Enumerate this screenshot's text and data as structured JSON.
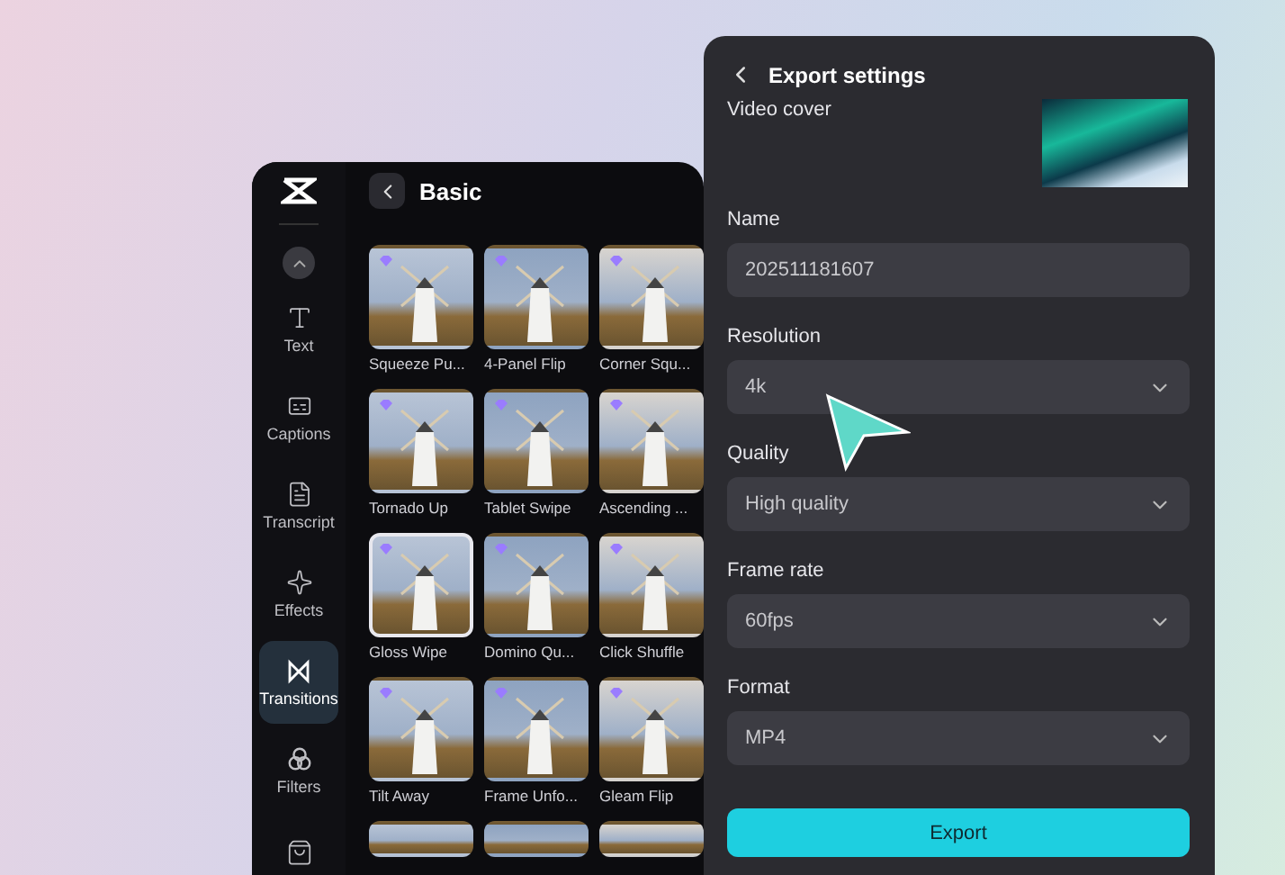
{
  "editor": {
    "title": "Basic",
    "sidebar": {
      "items": [
        {
          "label": "Text",
          "selected": false
        },
        {
          "label": "Captions",
          "selected": false
        },
        {
          "label": "Transcript",
          "selected": false
        },
        {
          "label": "Effects",
          "selected": false
        },
        {
          "label": "Transitions",
          "selected": true
        },
        {
          "label": "Filters",
          "selected": false
        }
      ]
    },
    "tiles": [
      {
        "label": "Squeeze Pu...",
        "selected": false
      },
      {
        "label": "4-Panel Flip",
        "selected": false
      },
      {
        "label": "Corner Squ...",
        "selected": false
      },
      {
        "label": "Tornado Up",
        "selected": false
      },
      {
        "label": "Tablet Swipe",
        "selected": false
      },
      {
        "label": "Ascending ...",
        "selected": false
      },
      {
        "label": "Gloss Wipe",
        "selected": true
      },
      {
        "label": "Domino Qu...",
        "selected": false
      },
      {
        "label": "Click Shuffle",
        "selected": false
      },
      {
        "label": "Tilt Away",
        "selected": false
      },
      {
        "label": "Frame Unfo...",
        "selected": false
      },
      {
        "label": "Gleam Flip",
        "selected": false
      }
    ]
  },
  "export": {
    "title": "Export settings",
    "cover_label": "Video cover",
    "fields": [
      {
        "label": "Name",
        "value": "202511181607",
        "kind": "text"
      },
      {
        "label": "Resolution",
        "value": "4k",
        "kind": "select"
      },
      {
        "label": "Quality",
        "value": "High quality",
        "kind": "select"
      },
      {
        "label": "Frame rate",
        "value": "60fps",
        "kind": "select"
      },
      {
        "label": "Format",
        "value": "MP4",
        "kind": "select"
      }
    ],
    "button": "Export"
  }
}
